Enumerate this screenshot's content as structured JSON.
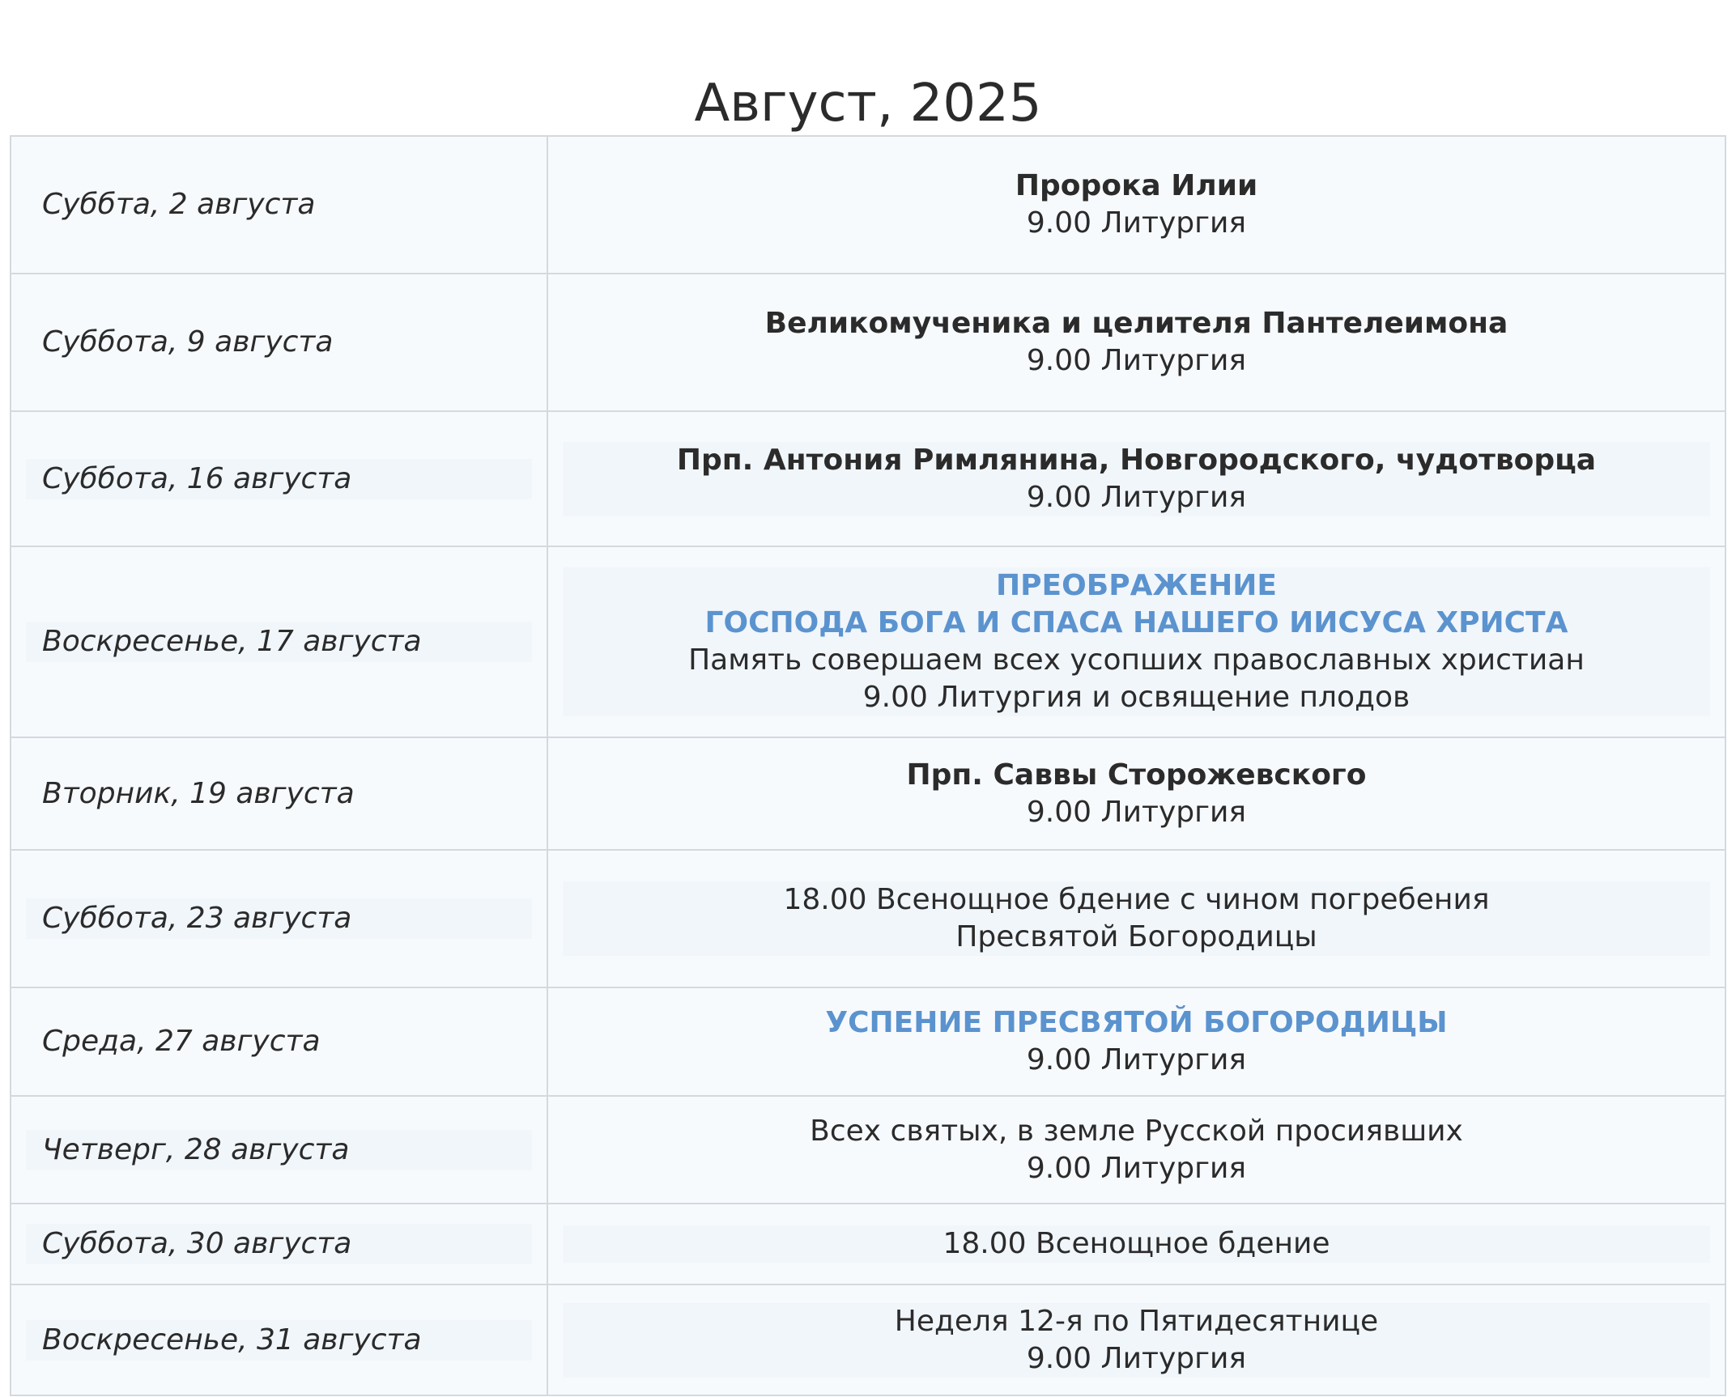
{
  "title": "Август, 2025",
  "rows": [
    {
      "date": "Суббта, 2 августа",
      "title": "Пророка Илии",
      "lines": [
        "9.00 Литургия"
      ]
    },
    {
      "date": "Суббота, 9 августа",
      "title": "Великомученика и целителя Пантелеимона",
      "lines": [
        "9.00 Литургия"
      ]
    },
    {
      "date": "Суббота, 16 августа",
      "title": "Прп. Антония Римлянина, Новгородского, чудотворца",
      "lines": [
        "9.00 Литургия"
      ]
    },
    {
      "date": "Воскресенье, 17 августа",
      "feast_lines": [
        "ПРЕОБРАЖЕНИЕ",
        "ГОСПОДА БОГА И СПАСА НАШЕГО ИИСУСА ХРИСТА"
      ],
      "lines": [
        "Память совершаем всех усопших православных христиан",
        "9.00 Литургия  и освящение плодов"
      ]
    },
    {
      "date": "Вторник, 19 августа",
      "title": "Прп. Саввы Сторожевского",
      "lines": [
        "9.00 Литургия"
      ]
    },
    {
      "date": "Суббота, 23 августа",
      "lines": [
        "18.00 Всенощное бдение  с чином погребения",
        "Пресвятой Богородицы"
      ]
    },
    {
      "date": "Среда, 27 августа",
      "feast_lines": [
        "УСПЕНИЕ ПРЕСВЯТОЙ БОГОРОДИЦЫ"
      ],
      "lines": [
        "9.00 Литургия"
      ]
    },
    {
      "date": "Четверг, 28 августа",
      "lines": [
        "Всех святых, в земле Русской просиявших",
        "9.00  Литургия"
      ]
    },
    {
      "date": "Суббота, 30 августа",
      "lines": [
        "18.00 Всенощное бдение"
      ]
    },
    {
      "date": "Воскресенье, 31 августа",
      "lines": [
        "Неделя 12-я по Пятидесятнице",
        "9.00  Литургия"
      ]
    }
  ],
  "colors": {
    "feast": "#5b93cf",
    "text": "#2b2b2b",
    "border": "#d4d9de",
    "cell_bg": "#f7fafd"
  }
}
